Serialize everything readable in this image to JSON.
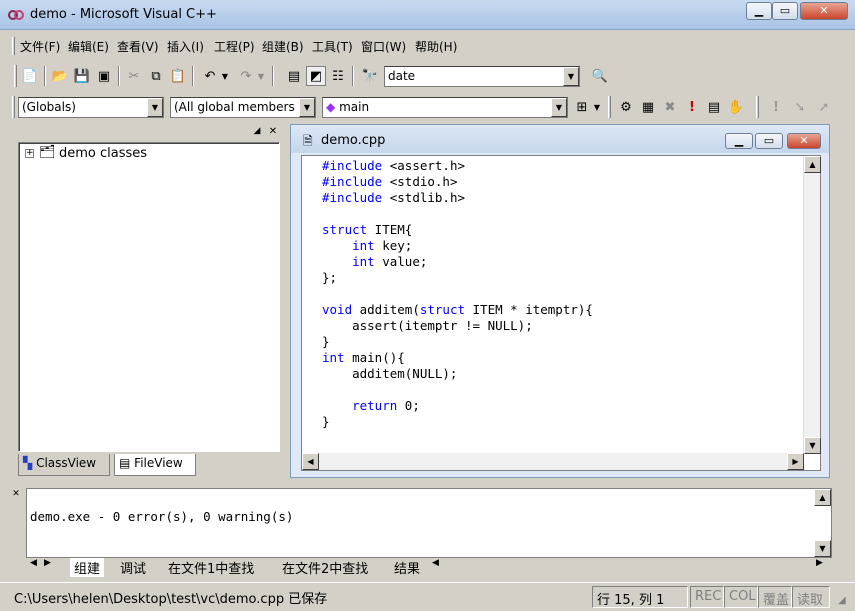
{
  "window": {
    "title": "demo - Microsoft Visual C++"
  },
  "menu": [
    "文件(F)",
    "编辑(E)",
    "查看(V)",
    "插入(I)",
    "工程(P)",
    "组建(B)",
    "工具(T)",
    "窗口(W)",
    "帮助(H)"
  ],
  "toolbar": {
    "find_combo_value": "date"
  },
  "wizardbar": {
    "class_combo": "(Globals)",
    "filter_combo": "(All global members",
    "member_combo": "main"
  },
  "workspace": {
    "tree_root": "demo classes",
    "tabs": [
      "ClassView",
      "FileView"
    ],
    "active_tab": "FileView"
  },
  "editor": {
    "title": "demo.cpp",
    "code_lines": [
      "#include <assert.h>",
      "#include <stdio.h>",
      "#include <stdlib.h>",
      "",
      "struct ITEM{",
      "    int key;",
      "    int value;",
      "};",
      "",
      "void additem(struct ITEM * itemptr){",
      "    assert(itemptr != NULL);",
      "}",
      "int main(){",
      "    additem(NULL);",
      "",
      "    return 0;",
      "}"
    ]
  },
  "output": {
    "text": "demo.exe - 0 error(s), 0 warning(s)",
    "tabs": [
      "组建",
      "调试",
      "在文件1中查找",
      "在文件2中查找",
      "结果"
    ]
  },
  "statusbar": {
    "message": "C:\\Users\\helen\\Desktop\\test\\vc\\demo.cpp 已保存",
    "position": "行 15, 列 1",
    "indicators": [
      "REC",
      "COL",
      "覆盖",
      "读取"
    ]
  },
  "colors": {
    "keyword": "#0000ff"
  }
}
